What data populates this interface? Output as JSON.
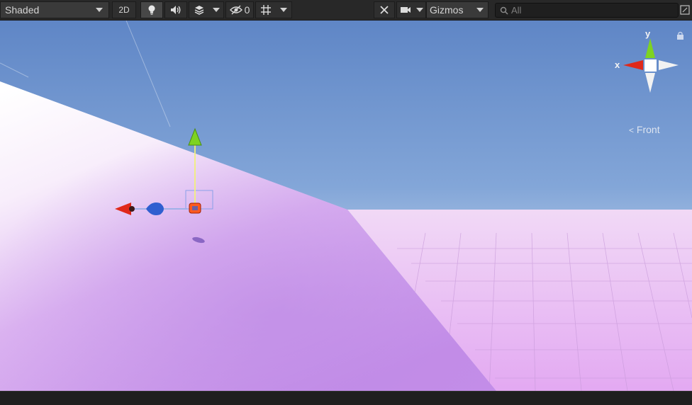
{
  "toolbar": {
    "draw_mode": "Shaded",
    "mode_2d": "2D",
    "hidden_count": "0",
    "gizmos": "Gizmos",
    "search_placeholder": "All"
  },
  "orientation_gizmo": {
    "x_label": "x",
    "y_label": "y",
    "view_label": "Front"
  },
  "icons": [
    "caret-down",
    "lightbulb",
    "audio",
    "effects-layers",
    "visibility-eye",
    "grid",
    "tools",
    "camera",
    "search",
    "maximize",
    "lock"
  ],
  "colors": {
    "x_axis": "#e0291a",
    "y_axis": "#7ed321",
    "z_axis": "#2f5fd0",
    "sky_top": "#6b93cf",
    "ground": "#cfa8f2"
  }
}
